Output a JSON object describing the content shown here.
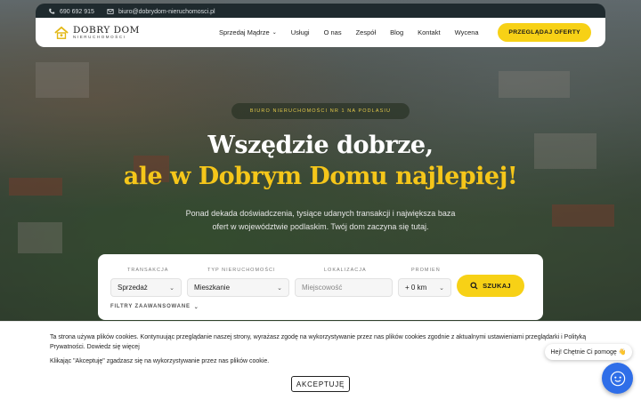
{
  "topbar": {
    "phone": "690 692 915",
    "email": "biuro@dobrydom-nieruchomosci.pl"
  },
  "logo": {
    "name": "DOBRY DOM",
    "tagline": "NIERUCHOMOŚCI"
  },
  "nav": {
    "items": [
      "Sprzedaj Mądrze",
      "Usługi",
      "O nas",
      "Zespół",
      "Blog",
      "Kontakt",
      "Wycena"
    ],
    "cta": "PRZEGLĄDAJ OFERTY"
  },
  "hero": {
    "badge": "BIURO NIERUCHOMOŚCI NR 1 NA PODLASIU",
    "headline_line1": "Wszędzie dobrze,",
    "headline_line2": "ale w Dobrym Domu najlepiej!",
    "lead": "Ponad dekada doświadczenia, tysiące udanych transakcji i największa baza ofert w województwie podlaskim. Twój dom zaczyna się tutaj."
  },
  "search": {
    "labels": {
      "transaction": "TRANSAKCJA",
      "property_type": "TYP NIERUCHOMOŚCI",
      "location": "LOKALIZACJA",
      "radius": "PROMIEŃ"
    },
    "transaction_value": "Sprzedaż",
    "property_type_value": "Mieszkanie",
    "location_placeholder": "Miejscowość",
    "radius_value": "+ 0 km",
    "button": "SZUKAJ",
    "advanced": "FILTRY ZAAWANSOWANE"
  },
  "cookie": {
    "text": "Ta strona używa plików cookies. Kontynuując przeglądanie naszej strony, wyrażasz zgodę na wykorzystywanie przez nas plików cookies zgodnie z aktualnymi ustawieniami przeglądarki i Polityką Prywatności. Dowiedz się więcej",
    "text2": "Klikając \"Akceptuję\" zgadzasz się na wykorzystywanie przez nas plików cookie.",
    "accept": "AKCEPTUJĘ"
  },
  "chat": {
    "bubble": "Hej! Chętnie Ci pomogę 👋"
  },
  "colors": {
    "accent": "#f7d116",
    "headline_accent": "#f5c61a",
    "chat": "#2f6ee8"
  }
}
